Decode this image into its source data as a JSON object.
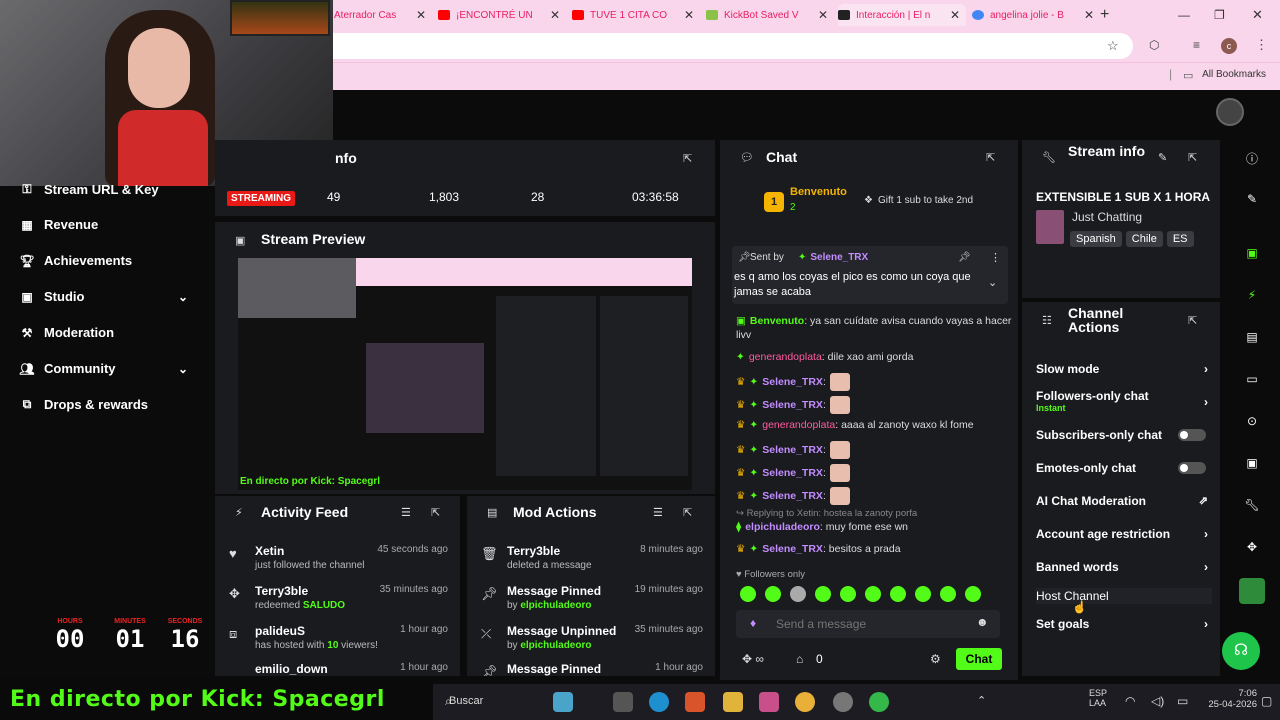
{
  "browser": {
    "tabs": [
      {
        "label": "Aterrador Cas",
        "color": "#ff0000"
      },
      {
        "label": "¡ENCONTRÉ UN",
        "color": "#ff0000"
      },
      {
        "label": "TUVE 1 CITA CO",
        "color": "#ff0000"
      },
      {
        "label": "KickBot Saved V",
        "color": "#8bc34a"
      },
      {
        "label": "Interacción | El n",
        "color": "#222222"
      },
      {
        "label": "angelina jolie - B",
        "color": "#4285f4"
      }
    ],
    "new_tab": "+",
    "all_bookmarks": "All Bookmarks"
  },
  "sidebar": {
    "items": [
      {
        "label": "Stream URL & Key",
        "icon": "key-icon"
      },
      {
        "label": "Revenue",
        "icon": "revenue-icon"
      },
      {
        "label": "Achievements",
        "icon": "trophy-icon"
      },
      {
        "label": "Studio",
        "icon": "studio-icon"
      },
      {
        "label": "Moderation",
        "icon": "gavel-icon"
      },
      {
        "label": "Community",
        "icon": "community-icon"
      },
      {
        "label": "Drops & rewards",
        "icon": "gift-icon"
      }
    ]
  },
  "timer": {
    "hours_label": "HOURS",
    "hours": "00",
    "minutes_label": "MINUTES",
    "minutes": "01",
    "seconds_label": "SECONDS",
    "seconds": "16"
  },
  "banner": "En directo por Kick: Spacegrl",
  "session": {
    "title_fragment": "nfo",
    "status": "STREAMING",
    "viewers": "49",
    "followers": "1,803",
    "subs": "28",
    "duration": "03:36:58"
  },
  "preview": {
    "title": "Stream Preview",
    "overlay_text": "En directo por Kick: Spacegrl"
  },
  "activity": {
    "title": "Activity Feed",
    "rows": [
      {
        "name": "Xetin",
        "sub": "just followed the channel",
        "time": "45 seconds ago"
      },
      {
        "name": "Terry3ble",
        "sub_prefix": "redeemed ",
        "sub_highlight": "SALUDO",
        "time": "35 minutes ago"
      },
      {
        "name": "palideuS",
        "sub_prefix": "has hosted with ",
        "sub_highlight": "10",
        "sub_suffix": " viewers!",
        "time": "1 hour ago"
      },
      {
        "name": "emilio_down",
        "time": "1 hour ago"
      }
    ]
  },
  "mod": {
    "title": "Mod Actions",
    "rows": [
      {
        "name": "Terry3ble",
        "sub": "deleted a message",
        "time": "8 minutes ago"
      },
      {
        "name": "Message Pinned",
        "sub_prefix": "by ",
        "sub_highlight": "elpichuladeoro",
        "time": "19 minutes ago"
      },
      {
        "name": "Message Unpinned",
        "sub_prefix": "by ",
        "sub_highlight": "elpichuladeoro",
        "time": "35 minutes ago"
      },
      {
        "name": "Message Pinned",
        "time": "1 hour ago"
      }
    ]
  },
  "chat": {
    "title": "Chat",
    "top_gifter": {
      "name": "Benvenuto",
      "count": "2",
      "rank": "1"
    },
    "gift_text": "Gift 1 sub to take 2nd",
    "pinned": {
      "sent_by": "Sent by",
      "user": "Selene_TRX",
      "text": "es q amo los coyas el pico es como un coya que jamas se acaba"
    },
    "messages": [
      {
        "user": "Benvenuto",
        "text": "ya san cuídate avisa cuando vayas a hacer livv"
      },
      {
        "user": "generandoplata",
        "text": "dile xao ami gorda"
      },
      {
        "user": "Selene_TRX",
        "text": ""
      },
      {
        "user": "Selene_TRX",
        "text": ""
      },
      {
        "user": "generandoplata",
        "text": "aaaa al zanoty waxo kl fome"
      },
      {
        "user": "Selene_TRX",
        "text": ""
      },
      {
        "user": "Selene_TRX",
        "text": ""
      },
      {
        "user": "Selene_TRX",
        "text": ""
      },
      {
        "reply": "Replying to Xetin: hostea la zanoty porfa"
      },
      {
        "user": "elpichuladeoro",
        "text": "muy fome ese wn"
      },
      {
        "user": "Selene_TRX",
        "text": "besitos a prada"
      }
    ],
    "followers_only": "Followers only",
    "input_placeholder": "Send a message",
    "points": "0",
    "send_label": "Chat"
  },
  "stream_info": {
    "title": "Stream info",
    "stream_title": "EXTENSIBLE 1 SUB X 1 HORA",
    "category": "Just Chatting",
    "tags": [
      "Spanish",
      "Chile",
      "ES"
    ]
  },
  "channel_actions": {
    "title": "Channel Actions",
    "items": [
      {
        "label": "Slow mode",
        "control": "chevron"
      },
      {
        "label": "Followers-only chat",
        "sub": "Instant",
        "control": "chevron"
      },
      {
        "label": "Subscribers-only chat",
        "control": "toggle"
      },
      {
        "label": "Emotes-only chat",
        "control": "toggle"
      },
      {
        "label": "AI Chat Moderation",
        "control": "external"
      },
      {
        "label": "Account age restriction",
        "control": "chevron"
      },
      {
        "label": "Banned words",
        "control": "chevron"
      },
      {
        "label": "Host Channel",
        "control": "none"
      },
      {
        "label": "Set goals",
        "control": "chevron"
      }
    ]
  },
  "taskbar": {
    "search": "Buscar",
    "lang": "ESP",
    "lang_sub": "LAA",
    "time": "7:06",
    "date": "25-04-2026"
  },
  "colors": {
    "brand": "#53fc18",
    "panel": "#191b1f",
    "live": "#e91916",
    "tabbar": "#f9d6ec"
  }
}
